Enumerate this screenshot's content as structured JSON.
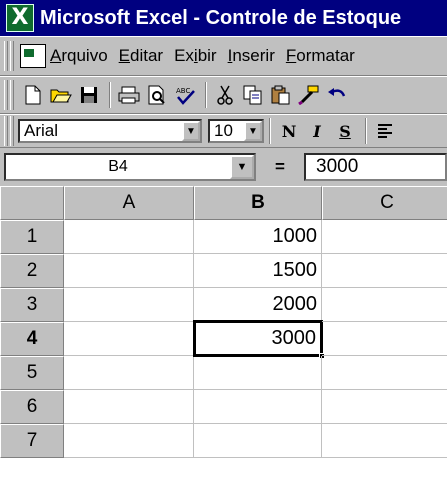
{
  "window": {
    "title": "Microsoft Excel - Controle de Estoque",
    "icon": "excel-icon"
  },
  "menu": {
    "items": [
      {
        "label": "Arquivo"
      },
      {
        "label": "Editar"
      },
      {
        "label": "Exibir"
      },
      {
        "label": "Inserir"
      },
      {
        "label": "Formatar"
      }
    ]
  },
  "toolbar": {
    "buttons": [
      "new-icon",
      "open-icon",
      "save-icon",
      "print-icon",
      "print-preview-icon",
      "spelling-icon",
      "cut-icon",
      "copy-icon",
      "paste-icon",
      "format-painter-icon",
      "undo-icon"
    ]
  },
  "formatting": {
    "font": "Arial",
    "size": "10",
    "bold": "N",
    "italic": "I",
    "underline": "S"
  },
  "formula_bar": {
    "name_box": "B4",
    "equals": "=",
    "value": "3000"
  },
  "grid": {
    "columns": [
      "A",
      "B",
      "C"
    ],
    "rows": [
      "1",
      "2",
      "3",
      "4",
      "5",
      "6",
      "7"
    ],
    "active_column": "B",
    "active_row": "4",
    "cells": {
      "B1": "1000",
      "B2": "1500",
      "B3": "2000",
      "B4": "3000"
    }
  }
}
